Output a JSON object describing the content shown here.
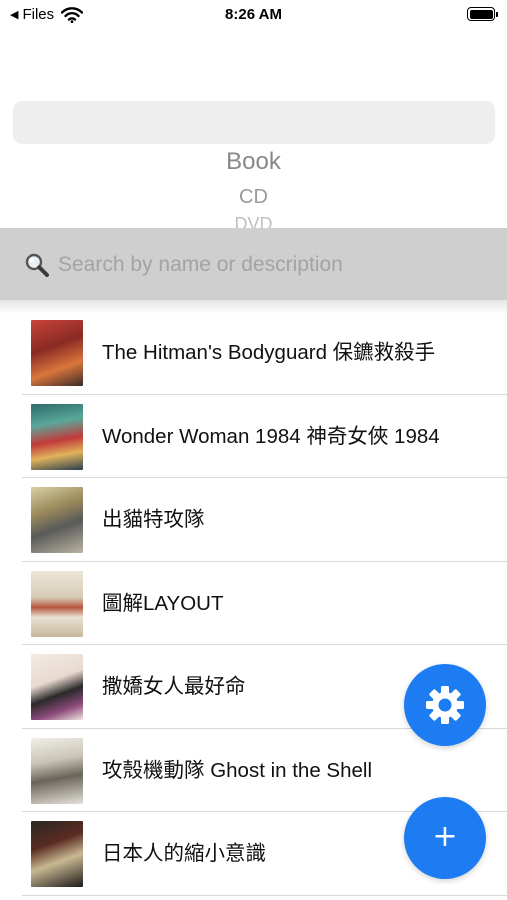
{
  "status_bar": {
    "back_label": "Files",
    "time": "8:26 AM"
  },
  "picker": {
    "options": [
      "Book",
      "CD",
      "DVD"
    ]
  },
  "search": {
    "placeholder": "Search by name or description",
    "value": ""
  },
  "items": [
    {
      "title": "The Hitman's Bodyguard 保鑣救殺手"
    },
    {
      "title": "Wonder Woman 1984 神奇女俠 1984"
    },
    {
      "title": "出貓特攻隊"
    },
    {
      "title": "圖解LAYOUT"
    },
    {
      "title": "撒嬌女人最好命"
    },
    {
      "title": "攻殼機動隊 Ghost in the Shell"
    },
    {
      "title": "日本人的縮小意識"
    }
  ],
  "actions": {
    "settings_icon": "gear-icon",
    "add_icon": "plus-icon",
    "add_glyph": "+"
  },
  "colors": {
    "accent": "#1e7cf2",
    "search_bar_bg": "#cfcfcf",
    "picker_bg": "#eeeeef"
  }
}
